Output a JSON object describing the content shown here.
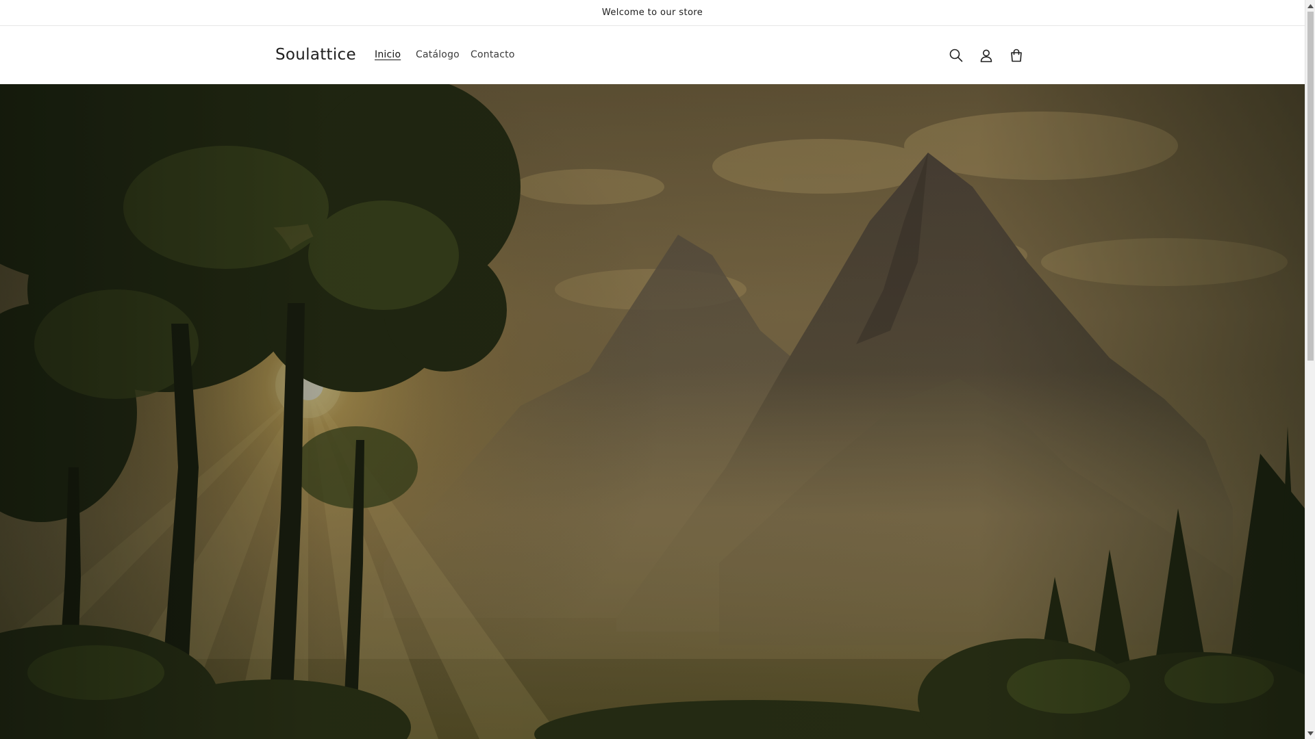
{
  "announcement": {
    "text": "Welcome to our store"
  },
  "header": {
    "logo": "Soulattice",
    "nav": [
      {
        "label": "Inicio",
        "active": true
      },
      {
        "label": "Catálogo",
        "active": false
      },
      {
        "label": "Contacto",
        "active": false
      }
    ],
    "icons": {
      "search": "search-icon",
      "account": "account-icon",
      "cart": "cart-icon"
    }
  },
  "hero": {
    "image": "forest-mountain-sunrise",
    "overlay_color": "#000000"
  },
  "scrollbar": {
    "position_fraction": 0.0
  },
  "colors": {
    "text": "#121212",
    "background": "#ffffff",
    "border": "#e6e6e6"
  }
}
